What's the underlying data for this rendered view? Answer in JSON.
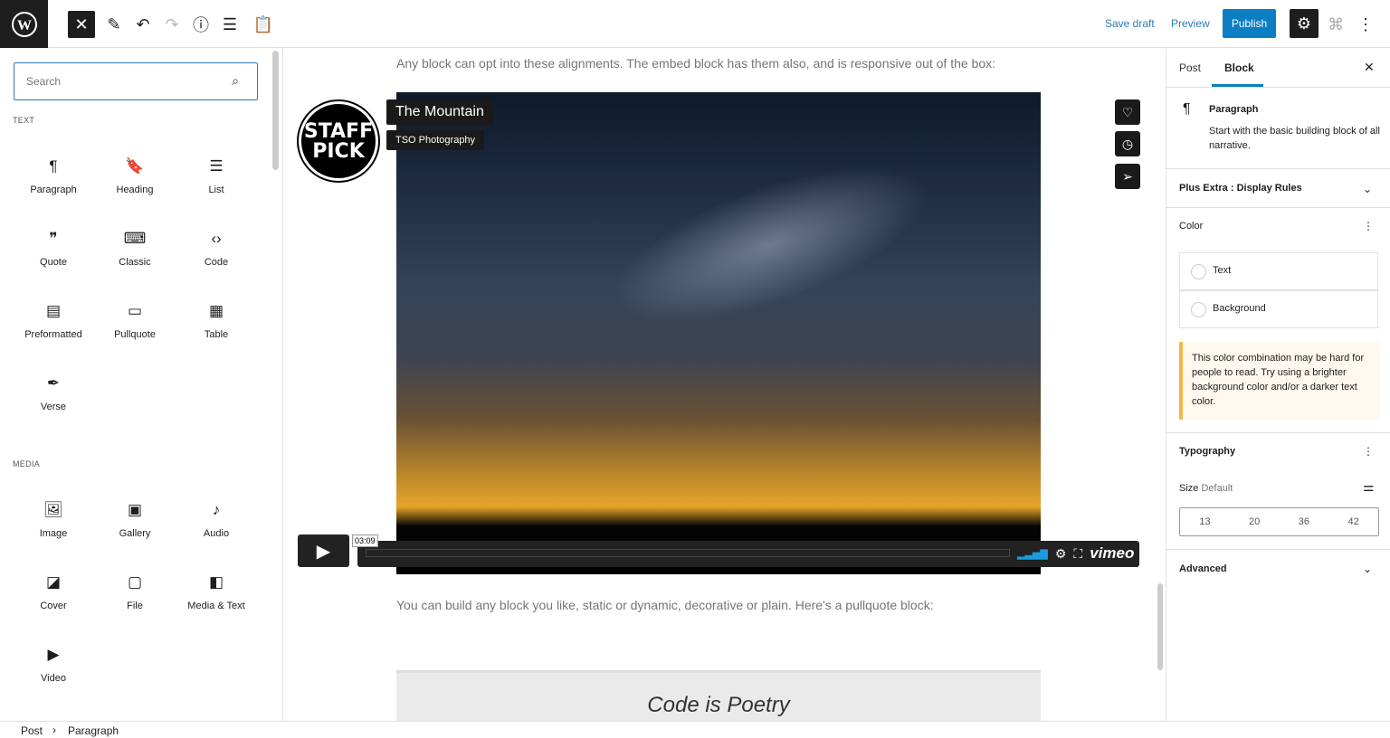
{
  "toolbar": {
    "close": "✕",
    "save_draft": "Save draft",
    "preview": "Preview",
    "publish": "Publish"
  },
  "inserter": {
    "search_placeholder": "Search",
    "text_section": "TEXT",
    "text_blocks": [
      {
        "label": "Paragraph",
        "icon": "¶"
      },
      {
        "label": "Heading",
        "icon": "🔖"
      },
      {
        "label": "List",
        "icon": "☰"
      },
      {
        "label": "Quote",
        "icon": "❞"
      },
      {
        "label": "Classic",
        "icon": "⌨"
      },
      {
        "label": "Code",
        "icon": "‹›"
      },
      {
        "label": "Preformatted",
        "icon": "▤"
      },
      {
        "label": "Pullquote",
        "icon": "▭"
      },
      {
        "label": "Table",
        "icon": "▦"
      },
      {
        "label": "Verse",
        "icon": "✒"
      }
    ],
    "media_section": "MEDIA",
    "media_blocks": [
      {
        "label": "Image",
        "icon": "🖼"
      },
      {
        "label": "Gallery",
        "icon": "▣"
      },
      {
        "label": "Audio",
        "icon": "♪"
      },
      {
        "label": "Cover",
        "icon": "◪"
      },
      {
        "label": "File",
        "icon": "▢"
      },
      {
        "label": "Media & Text",
        "icon": "◧"
      },
      {
        "label": "Video",
        "icon": "▶"
      }
    ]
  },
  "content": {
    "para1": "Any block can opt into these alignments. The embed block has them also, and is responsive out of the box:",
    "video": {
      "title": "The Mountain",
      "author": "TSO Photography",
      "badge": "STAFF PICK",
      "time": "03:09",
      "brand": "vimeo"
    },
    "para2": "You can build any block you like, static or dynamic, decorative or plain. Here's a pullquote block:",
    "pullquote": "Code is Poetry"
  },
  "sidebar": {
    "tabs": [
      "Post",
      "Block"
    ],
    "active_tab": "Block",
    "block_name": "Paragraph",
    "block_desc": "Start with the basic building block of all narrative.",
    "plus_extra": "Plus Extra : Display Rules",
    "color": "Color",
    "color_text": "Text",
    "color_background": "Background",
    "warning": "This color combination may be hard for people to read. Try using a brighter background color and/or a darker text color.",
    "typography": "Typography",
    "size_label": "Size",
    "size_value": "Default",
    "sizes": [
      "13",
      "20",
      "36",
      "42"
    ],
    "advanced": "Advanced"
  },
  "breadcrumb": [
    "Post",
    "Paragraph"
  ],
  "colors": {
    "accent": "#0b7fc1",
    "warning": "#f0b849"
  }
}
